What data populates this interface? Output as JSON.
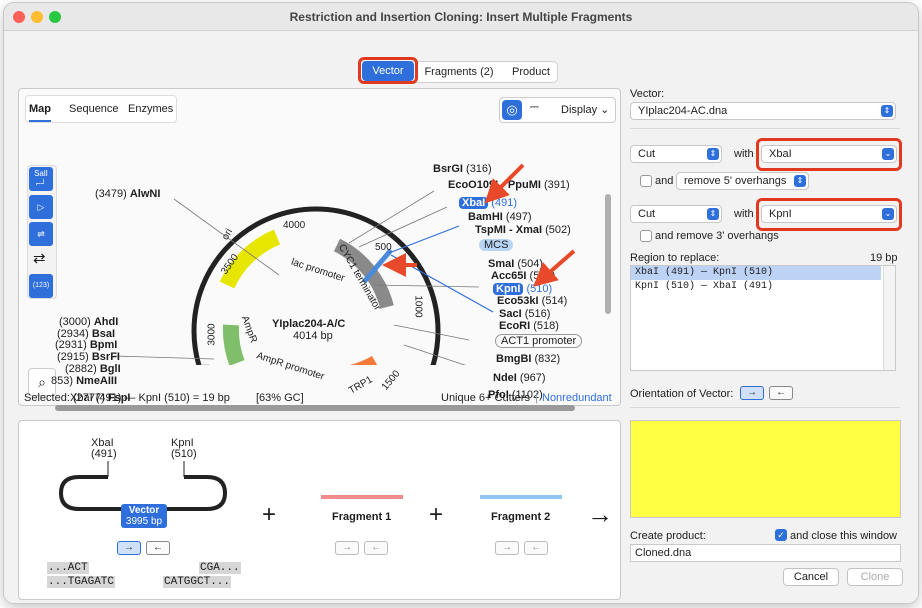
{
  "window": {
    "title": "Restriction and Insertion Cloning: Insert Multiple Fragments"
  },
  "tabs": [
    {
      "label": "Vector"
    },
    {
      "label": "Fragments (2)"
    },
    {
      "label": "Product"
    }
  ],
  "map_tabs": [
    {
      "label": "Map"
    },
    {
      "label": "Sequence"
    },
    {
      "label": "Enzymes"
    }
  ],
  "display_label": "Display",
  "plasmid": {
    "name": "YIplac204-A/C",
    "size": "4014 bp",
    "ticks": [
      "500",
      "1000",
      "1500",
      "3000",
      "3500",
      "4000"
    ],
    "features": [
      "ori",
      "AmpR",
      "AmpR promoter",
      "lac promoter",
      "CYC1 terminator",
      "TRP1",
      "MCS",
      "ACT1 promoter"
    ]
  },
  "enzymes_right": [
    {
      "name": "BsrGI",
      "pos": "(316)"
    },
    {
      "name": "EcoO109I - PpuMI",
      "pos": "(391)"
    },
    {
      "name": "XbaI",
      "pos": "(491)"
    },
    {
      "name": "BamHI",
      "pos": "(497)"
    },
    {
      "name": "TspMI - XmaI",
      "pos": "(502)"
    },
    {
      "name": "SmaI",
      "pos": "(504)"
    },
    {
      "name": "Acc65I",
      "pos": "(506)"
    },
    {
      "name": "KpnI",
      "pos": "(510)"
    },
    {
      "name": "Eco53kI",
      "pos": "(514)"
    },
    {
      "name": "SacI",
      "pos": "(516)"
    },
    {
      "name": "EcoRI",
      "pos": "(518)"
    },
    {
      "name": "BmgBI",
      "pos": "(832)"
    },
    {
      "name": "NdeI",
      "pos": "(967)"
    },
    {
      "name": "PfoI",
      "pos": "(1102)"
    }
  ],
  "enzymes_left": [
    {
      "name": "AlwNI",
      "pos": "(3479)"
    },
    {
      "name": "AhdI",
      "pos": "(3000)"
    },
    {
      "name": "BsaI",
      "pos": "(2934)"
    },
    {
      "name": "BpmI",
      "pos": "(2931)"
    },
    {
      "name": "BsrFI",
      "pos": "(2915)"
    },
    {
      "name": "BglI",
      "pos": "(2882)"
    },
    {
      "name": "NmeAIII",
      "pos": "853)"
    },
    {
      "name": "FspI",
      "pos": "(2777)"
    }
  ],
  "side_tools": {
    "sali": "SalI",
    "numbers": "(123)"
  },
  "map_status": {
    "selected_label": "Selected:",
    "selection": "XbaI (491)  —  KpnI (510)  =  19 bp",
    "gc": "[63% GC]",
    "cutters": "Unique 6+ Cutters",
    "nonredundant": "Nonredundant"
  },
  "right": {
    "vector_label": "Vector:",
    "vector_value": "YIplac204-AC.dna",
    "cut1": {
      "action": "Cut",
      "with": "with",
      "enzyme": "XbaI",
      "and": "and",
      "overhang": "remove 5' overhangs"
    },
    "cut2": {
      "action": "Cut",
      "with": "with",
      "enzyme": "KpnI",
      "and": "and remove 3' overhangs"
    },
    "region_label": "Region to replace:",
    "region_size": "19 bp",
    "regions": [
      "XbaI (491)  —  KpnI (510)",
      "KpnI (510)  —  XbaI (491)"
    ],
    "orientation_label": "Orientation of Vector:",
    "preview_color": "#ffff44",
    "create_label": "Create product:",
    "close_label": "and close this window",
    "product_name": "Cloned.dna",
    "cancel": "Cancel",
    "clone": "Clone"
  },
  "bottom": {
    "left_site": {
      "name": "XbaI",
      "pos": "(491)"
    },
    "right_site": {
      "name": "KpnI",
      "pos": "(510)"
    },
    "vector_name": "Vector",
    "vector_size": "3995 bp",
    "seq_left_top": "...ACT",
    "seq_left_bottom": "...TGAGATC",
    "seq_right_top": "CGA...",
    "seq_right_bottom": "CATGGCT...",
    "plus": "+",
    "arrow": "→",
    "fragment1": {
      "label": "Fragment 1",
      "color": "#f28c8c"
    },
    "fragment2": {
      "label": "Fragment 2",
      "color": "#8fc6f5"
    }
  },
  "colors": {
    "accent": "#2f6fdc",
    "highlight": "#e0391f"
  }
}
